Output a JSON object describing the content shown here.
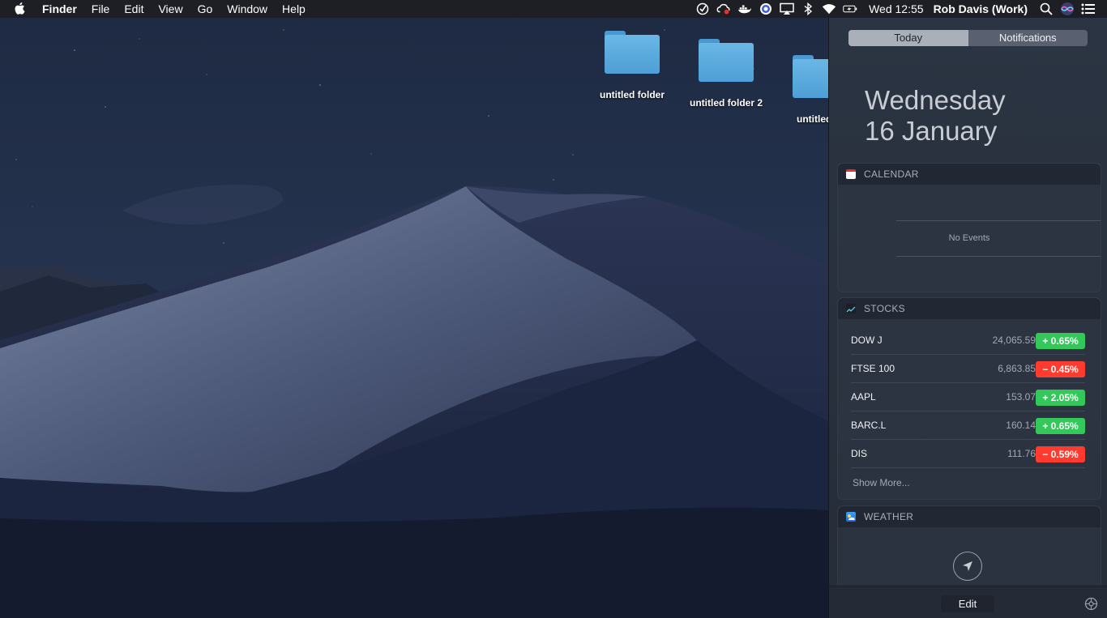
{
  "menubar": {
    "app_name": "Finder",
    "menus": [
      "File",
      "Edit",
      "View",
      "Go",
      "Window",
      "Help"
    ],
    "clock": "Wed 12:55",
    "user": "Rob Davis (Work)",
    "status_icons": [
      "omnifocus-icon",
      "creative-cloud-icon",
      "docker-icon",
      "browser-extension-icon",
      "airplay-icon",
      "bluetooth-icon",
      "wifi-icon",
      "battery-icon",
      "spotlight-icon",
      "siri-icon",
      "notification-center-icon"
    ]
  },
  "desktop": {
    "folders": [
      {
        "label": "untitled folder"
      },
      {
        "label": "untitled folder 2"
      },
      {
        "label": "untitled fo"
      }
    ]
  },
  "notification_center": {
    "tabs": {
      "today": "Today",
      "notifications": "Notifications"
    },
    "date_line1": "Wednesday",
    "date_line2": "16 January",
    "calendar": {
      "title": "CALENDAR",
      "empty_text": "No Events"
    },
    "stocks": {
      "title": "STOCKS",
      "items": [
        {
          "symbol": "DOW J",
          "price": "24,065.59",
          "change": "+ 0.65%",
          "direction": "up"
        },
        {
          "symbol": "FTSE 100",
          "price": "6,863.85",
          "change": "− 0.45%",
          "direction": "down"
        },
        {
          "symbol": "AAPL",
          "price": "153.07",
          "change": "+ 2.05%",
          "direction": "up"
        },
        {
          "symbol": "BARC.L",
          "price": "160.14",
          "change": "+ 0.65%",
          "direction": "up"
        },
        {
          "symbol": "DIS",
          "price": "111.76",
          "change": "− 0.59%",
          "direction": "down"
        }
      ],
      "show_more": "Show More..."
    },
    "weather": {
      "title": "WEATHER"
    },
    "footer": {
      "edit_label": "Edit"
    }
  },
  "colors": {
    "stock_up": "#34c759",
    "stock_down": "#ff3b30"
  }
}
